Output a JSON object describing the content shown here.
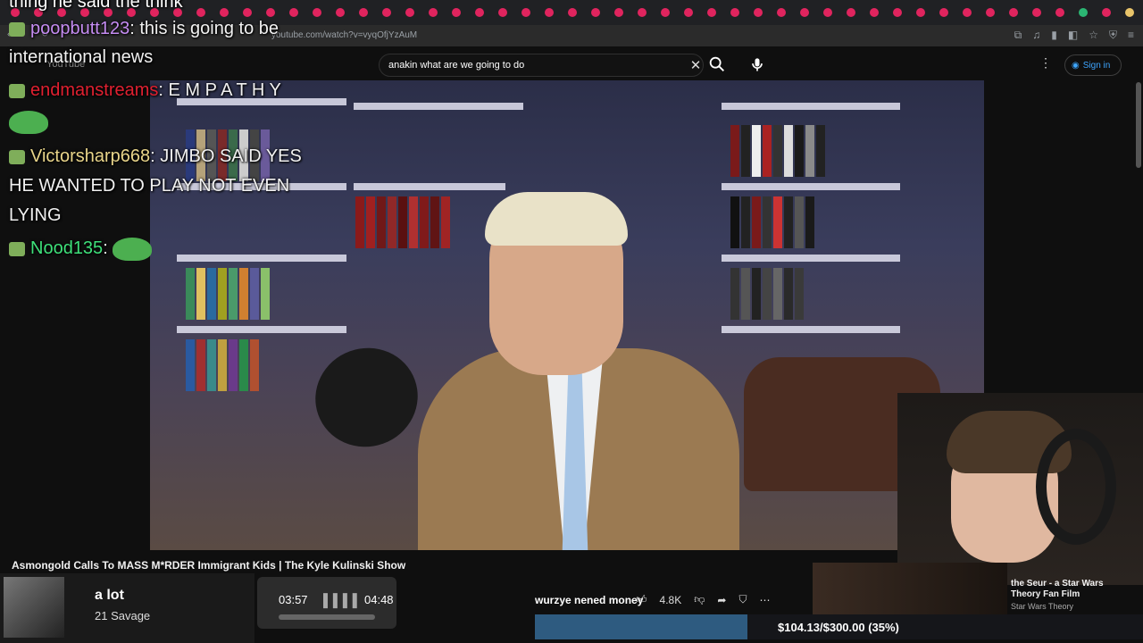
{
  "browser": {
    "url": "youtube.com/watch?v=vyqOfjYzAuM"
  },
  "youtube": {
    "logo_text": "YouTube",
    "search_value": "anakin what are we going to do",
    "signin_label": "Sign in"
  },
  "chat": {
    "top_cut_text": "thing he said the think",
    "messages": [
      {
        "user": "poopbutt123",
        "text": "this is going to be"
      },
      {
        "user": "",
        "text": "international news"
      },
      {
        "user": "endmanstreams",
        "text": "E M P A T H Y"
      },
      {
        "user": "Victorsharp668",
        "text": "JIMBO SAID YES"
      },
      {
        "user": "",
        "text": "HE WANTED TO PLAY NOT EVEN"
      },
      {
        "user": "",
        "text": "LYING"
      },
      {
        "user": "Nood135",
        "text": ""
      }
    ]
  },
  "video": {
    "title": "Asmongold Calls To MASS M*RDER Immigrant Kids | The Kyle Kulinski Show",
    "likes": "4.8K"
  },
  "now_playing": {
    "track": "a lot",
    "artist": "21 Savage",
    "current_time": "03:57",
    "total_time": "04:48"
  },
  "donation": {
    "message": "wurzye nened money",
    "goal_text": "$104.13/$300.00 (35%)",
    "goal_fraction": 0.35
  },
  "recommendation": {
    "title": "the Seur - a Star Wars Theory Fan Film",
    "channel": "Star Wars Theory"
  },
  "colors": {
    "link_blue": "#3ea6ff",
    "goal_fill": "#2e5b80"
  }
}
